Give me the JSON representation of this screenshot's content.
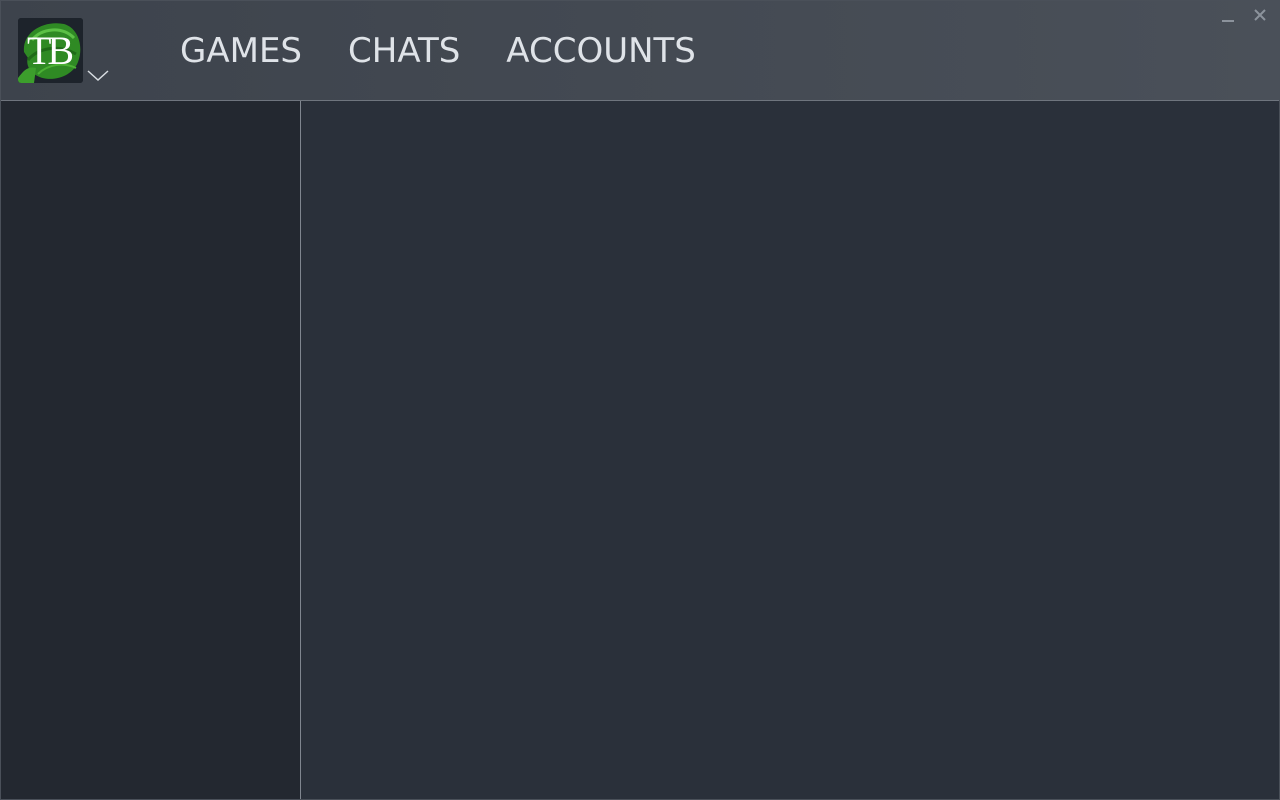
{
  "app": {
    "logo_text": "TB",
    "logo_icon": "tb-leaf-logo-icon",
    "dropdown_icon": "chevron-down-icon"
  },
  "nav": {
    "items": [
      {
        "label": "GAMES"
      },
      {
        "label": "CHATS"
      },
      {
        "label": "ACCOUNTS"
      }
    ]
  },
  "window_controls": {
    "minimize_icon": "minimize-icon",
    "close_icon": "close-icon"
  },
  "colors": {
    "header": "#444a53",
    "sidebar": "#232830",
    "main": "#2a303a",
    "logo_green": "#3a9a2a",
    "nav_text": "#dfe3e8"
  }
}
